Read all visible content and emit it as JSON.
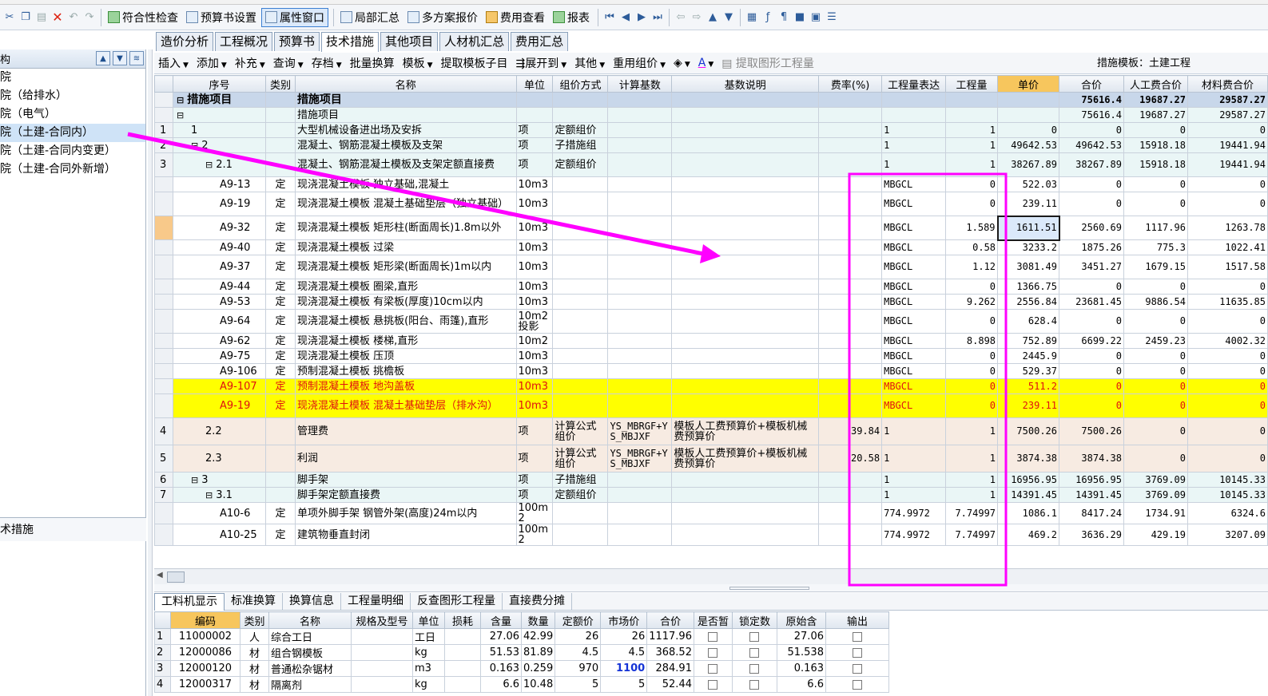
{
  "toolbar": {
    "items": [
      "符合性检查",
      "预算书设置",
      "属性窗口",
      "局部汇总",
      "多方案报价",
      "费用查看",
      "报表"
    ]
  },
  "tabs": [
    "造价分析",
    "工程概况",
    "预算书",
    "技术措施",
    "其他项目",
    "人材机汇总",
    "费用汇总"
  ],
  "left_panel": {
    "title": "构",
    "items": [
      "院",
      "院（给排水）",
      "院（电气）",
      "院（土建-合同内）",
      "院（土建-合同内变更）",
      "院（土建-合同外新增）"
    ],
    "bottom_label": "术措施"
  },
  "subtoolbar": {
    "items": [
      "插入",
      "添加",
      "补充",
      "查询",
      "存档",
      "批量换算",
      "模板",
      "提取模板子目",
      "展开到",
      "其他",
      "重用组价"
    ],
    "extract_label": "提取图形工程量",
    "template_label": "措施模板：土建工程"
  },
  "grid": {
    "columns": [
      "",
      "序号",
      "类别",
      "名称",
      "单位",
      "组价方式",
      "计算基数",
      "基数说明",
      "费率(%)",
      "工程量表达",
      "工程量",
      "单价",
      "合价",
      "人工费合价",
      "材料费合价"
    ],
    "rows": [
      {
        "idx": "",
        "seq": "措施项目",
        "cat": "",
        "name": "措施项目",
        "unit": "",
        "method": "",
        "base": "",
        "basedesc": "",
        "rate": "",
        "expr": "",
        "qty": "",
        "price": "",
        "total": "75616.4",
        "labor": "19687.27",
        "mat": "29587.27",
        "style": "hdrrow",
        "tree": "⊟"
      },
      {
        "idx": "",
        "seq": "",
        "cat": "",
        "name": "措施项目",
        "unit": "",
        "method": "",
        "base": "",
        "basedesc": "",
        "rate": "",
        "expr": "",
        "qty": "",
        "price": "",
        "total": "75616.4",
        "labor": "19687.27",
        "mat": "29587.27",
        "style": "sub",
        "tree": "⊟"
      },
      {
        "idx": "1",
        "seq": "1",
        "cat": "",
        "name": "大型机械设备进出场及安拆",
        "unit": "项",
        "method": "定额组价",
        "base": "",
        "basedesc": "",
        "rate": "",
        "expr": "1",
        "qty": "1",
        "price": "0",
        "total": "0",
        "labor": "0",
        "mat": "0",
        "style": "sub"
      },
      {
        "idx": "2",
        "seq": "2",
        "cat": "",
        "name": "混凝土、钢筋混凝土模板及支架",
        "unit": "项",
        "method": "子措施组",
        "base": "",
        "basedesc": "",
        "rate": "",
        "expr": "1",
        "qty": "1",
        "price": "49642.53",
        "total": "49642.53",
        "labor": "15918.18",
        "mat": "19441.94",
        "style": "sub",
        "tree": "⊟"
      },
      {
        "idx": "3",
        "seq": "2.1",
        "cat": "",
        "name": "混凝土、钢筋混凝土模板及支架定额直接费",
        "unit": "项",
        "method": "定额组价",
        "base": "",
        "basedesc": "",
        "rate": "",
        "expr": "1",
        "qty": "1",
        "price": "38267.89",
        "total": "38267.89",
        "labor": "15918.18",
        "mat": "19441.94",
        "style": "sub",
        "tree": "⊟",
        "tall": true
      },
      {
        "idx": "",
        "seq": "A9-13",
        "cat": "定",
        "name": "现浇混凝土模板 独立基础,混凝土",
        "unit": "10m3",
        "method": "",
        "base": "",
        "basedesc": "",
        "rate": "",
        "expr": "MBGCL",
        "qty": "0",
        "price": "522.03",
        "total": "0",
        "labor": "0",
        "mat": "0",
        "style": "plain"
      },
      {
        "idx": "",
        "seq": "A9-19",
        "cat": "定",
        "name": "现浇混凝土模板 混凝土基础垫层（独立基础）",
        "unit": "10m3",
        "method": "",
        "base": "",
        "basedesc": "",
        "rate": "",
        "expr": "MBGCL",
        "qty": "0",
        "price": "239.11",
        "total": "0",
        "labor": "0",
        "mat": "0",
        "style": "plain",
        "tall": true
      },
      {
        "idx": "",
        "seq": "A9-32",
        "cat": "定",
        "name": "现浇混凝土模板 矩形柱(断面周长)1.8m以外",
        "unit": "10m3",
        "method": "",
        "base": "",
        "basedesc": "",
        "rate": "",
        "expr": "MBGCL",
        "qty": "1.589",
        "price": "1611.51",
        "total": "2560.69",
        "labor": "1117.96",
        "mat": "1263.78",
        "style": "plain",
        "tall": true,
        "selected": true
      },
      {
        "idx": "",
        "seq": "A9-40",
        "cat": "定",
        "name": "现浇混凝土模板 过梁",
        "unit": "10m3",
        "method": "",
        "base": "",
        "basedesc": "",
        "rate": "",
        "expr": "MBGCL",
        "qty": "0.58",
        "price": "3233.2",
        "total": "1875.26",
        "labor": "775.3",
        "mat": "1022.41",
        "style": "plain"
      },
      {
        "idx": "",
        "seq": "A9-37",
        "cat": "定",
        "name": "现浇混凝土模板 矩形梁(断面周长)1m以内",
        "unit": "10m3",
        "method": "",
        "base": "",
        "basedesc": "",
        "rate": "",
        "expr": "MBGCL",
        "qty": "1.12",
        "price": "3081.49",
        "total": "3451.27",
        "labor": "1679.15",
        "mat": "1517.58",
        "style": "plain",
        "tall": true
      },
      {
        "idx": "",
        "seq": "A9-44",
        "cat": "定",
        "name": "现浇混凝土模板 圈梁,直形",
        "unit": "10m3",
        "method": "",
        "base": "",
        "basedesc": "",
        "rate": "",
        "expr": "MBGCL",
        "qty": "0",
        "price": "1366.75",
        "total": "0",
        "labor": "0",
        "mat": "0",
        "style": "plain"
      },
      {
        "idx": "",
        "seq": "A9-53",
        "cat": "定",
        "name": "现浇混凝土模板 有梁板(厚度)10cm以内",
        "unit": "10m3",
        "method": "",
        "base": "",
        "basedesc": "",
        "rate": "",
        "expr": "MBGCL",
        "qty": "9.262",
        "price": "2556.84",
        "total": "23681.45",
        "labor": "9886.54",
        "mat": "11635.85",
        "style": "plain"
      },
      {
        "idx": "",
        "seq": "A9-64",
        "cat": "定",
        "name": "现浇混凝土模板 悬挑板(阳台、雨篷),直形",
        "unit": "10m2投影",
        "method": "",
        "base": "",
        "basedesc": "",
        "rate": "",
        "expr": "MBGCL",
        "qty": "0",
        "price": "628.4",
        "total": "0",
        "labor": "0",
        "mat": "0",
        "style": "plain",
        "tall": true
      },
      {
        "idx": "",
        "seq": "A9-62",
        "cat": "定",
        "name": "现浇混凝土模板 楼梯,直形",
        "unit": "10m2",
        "method": "",
        "base": "",
        "basedesc": "",
        "rate": "",
        "expr": "MBGCL",
        "qty": "8.898",
        "price": "752.89",
        "total": "6699.22",
        "labor": "2459.23",
        "mat": "4002.32",
        "style": "plain"
      },
      {
        "idx": "",
        "seq": "A9-75",
        "cat": "定",
        "name": "现浇混凝土模板 压顶",
        "unit": "10m3",
        "method": "",
        "base": "",
        "basedesc": "",
        "rate": "",
        "expr": "MBGCL",
        "qty": "0",
        "price": "2445.9",
        "total": "0",
        "labor": "0",
        "mat": "0",
        "style": "plain"
      },
      {
        "idx": "",
        "seq": "A9-106",
        "cat": "定",
        "name": "预制混凝土模板 挑檐板",
        "unit": "10m3",
        "method": "",
        "base": "",
        "basedesc": "",
        "rate": "",
        "expr": "MBGCL",
        "qty": "0",
        "price": "529.37",
        "total": "0",
        "labor": "0",
        "mat": "0",
        "style": "plain"
      },
      {
        "idx": "",
        "seq": "A9-107",
        "cat": "定",
        "name": "预制混凝土模板 地沟盖板",
        "unit": "10m3",
        "method": "",
        "base": "",
        "basedesc": "",
        "rate": "",
        "expr": "MBGCL",
        "qty": "0",
        "price": "511.2",
        "total": "0",
        "labor": "0",
        "mat": "0",
        "style": "y"
      },
      {
        "idx": "",
        "seq": "A9-19",
        "cat": "定",
        "name": "现浇混凝土模板 混凝土基础垫层（排水沟）",
        "unit": "10m3",
        "method": "",
        "base": "",
        "basedesc": "",
        "rate": "",
        "expr": "MBGCL",
        "qty": "0",
        "price": "239.11",
        "total": "0",
        "labor": "0",
        "mat": "0",
        "style": "y",
        "tall": true
      },
      {
        "idx": "4",
        "seq": "2.2",
        "cat": "",
        "name": "管理费",
        "unit": "项",
        "method": "计算公式组价",
        "base": "YS_MBRGF+YS_MBJXF",
        "basedesc": "模板人工费预算价+模板机械费预算价",
        "rate": "39.84",
        "expr": "1",
        "qty": "1",
        "price": "7500.26",
        "total": "7500.26",
        "labor": "0",
        "mat": "0",
        "style": "tan",
        "tall2": true
      },
      {
        "idx": "5",
        "seq": "2.3",
        "cat": "",
        "name": "利润",
        "unit": "项",
        "method": "计算公式组价",
        "base": "YS_MBRGF+YS_MBJXF",
        "basedesc": "模板人工费预算价+模板机械费预算价",
        "rate": "20.58",
        "expr": "1",
        "qty": "1",
        "price": "3874.38",
        "total": "3874.38",
        "labor": "0",
        "mat": "0",
        "style": "tan",
        "tall2": true
      },
      {
        "idx": "6",
        "seq": "3",
        "cat": "",
        "name": "脚手架",
        "unit": "项",
        "method": "子措施组",
        "base": "",
        "basedesc": "",
        "rate": "",
        "expr": "1",
        "qty": "1",
        "price": "16956.95",
        "total": "16956.95",
        "labor": "3769.09",
        "mat": "10145.33",
        "style": "sub",
        "tree": "⊟"
      },
      {
        "idx": "7",
        "seq": "3.1",
        "cat": "",
        "name": "脚手架定额直接费",
        "unit": "项",
        "method": "定额组价",
        "base": "",
        "basedesc": "",
        "rate": "",
        "expr": "1",
        "qty": "1",
        "price": "14391.45",
        "total": "14391.45",
        "labor": "3769.09",
        "mat": "10145.33",
        "style": "sub",
        "tree": "⊟"
      },
      {
        "idx": "",
        "seq": "A10-6",
        "cat": "定",
        "name": "单项外脚手架 钢管外架(高度)24m以内",
        "unit": "100m2",
        "method": "",
        "base": "",
        "basedesc": "",
        "rate": "",
        "expr": "774.9972",
        "qty": "7.74997",
        "price": "1086.1",
        "total": "8417.24",
        "labor": "1734.91",
        "mat": "6324.6",
        "style": "plain"
      },
      {
        "idx": "",
        "seq": "A10-25",
        "cat": "定",
        "name": "建筑物垂直封闭",
        "unit": "100m2",
        "method": "",
        "base": "",
        "basedesc": "",
        "rate": "",
        "expr": "774.9972",
        "qty": "7.74997",
        "price": "469.2",
        "total": "3636.29",
        "labor": "429.19",
        "mat": "3207.09",
        "style": "plain"
      }
    ]
  },
  "bottom_tabs": [
    "工料机显示",
    "标准换算",
    "换算信息",
    "工程量明细",
    "反查图形工程量",
    "直接费分摊"
  ],
  "bottom_grid": {
    "columns": [
      "",
      "编码",
      "类别",
      "名称",
      "规格及型号",
      "单位",
      "损耗",
      "含量",
      "数量",
      "定额价",
      "市场价",
      "合价",
      "是否暂",
      "锁定数",
      "原始含",
      "输出"
    ],
    "rows": [
      {
        "idx": "1",
        "code": "11000002",
        "cat": "人",
        "name": "综合工日",
        "spec": "",
        "unit": "工日",
        "loss": "",
        "content": "27.06",
        "qty": "42.99",
        "quota": "26",
        "market": "26",
        "total": "1117.96",
        "orig": "27.06",
        "blue": false
      },
      {
        "idx": "2",
        "code": "12000086",
        "cat": "材",
        "name": "组合钢模板",
        "spec": "",
        "unit": "kg",
        "loss": "",
        "content": "51.53",
        "qty": "81.89",
        "quota": "4.5",
        "market": "4.5",
        "total": "368.52",
        "orig": "51.538",
        "blue": false
      },
      {
        "idx": "3",
        "code": "12000120",
        "cat": "材",
        "name": "普通松杂锯材",
        "spec": "",
        "unit": "m3",
        "loss": "",
        "content": "0.163",
        "qty": "0.259",
        "quota": "970",
        "market": "1100",
        "total": "284.91",
        "orig": "0.163",
        "blue": true
      },
      {
        "idx": "4",
        "code": "12000317",
        "cat": "材",
        "name": "隔离剂",
        "spec": "",
        "unit": "kg",
        "loss": "",
        "content": "6.6",
        "qty": "10.48",
        "quota": "5",
        "market": "5",
        "total": "52.44",
        "orig": "6.6",
        "blue": false
      }
    ]
  },
  "annotation": {
    "color": "#ff00ff"
  }
}
